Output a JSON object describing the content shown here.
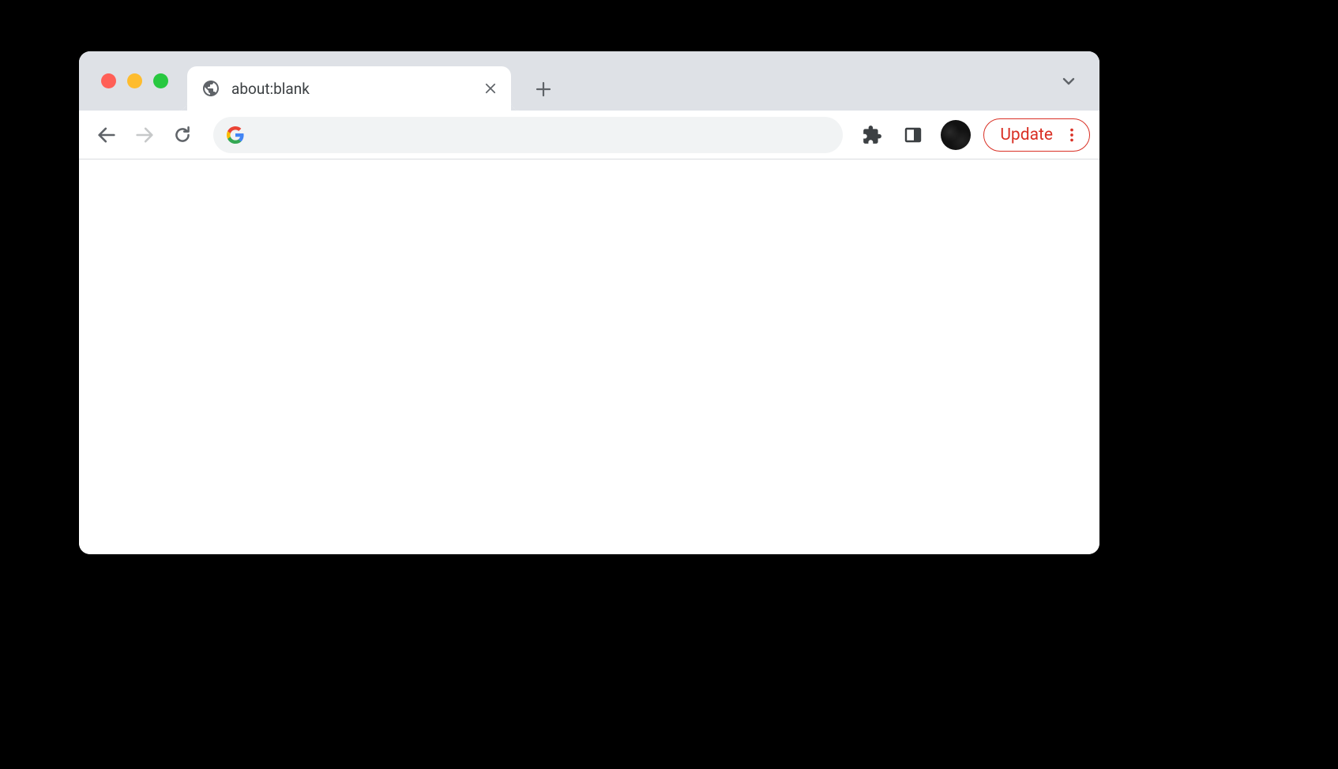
{
  "tab": {
    "title": "about:blank"
  },
  "omnibox": {
    "value": "",
    "placeholder": ""
  },
  "update": {
    "label": "Update"
  },
  "colors": {
    "accent_red": "#d93025",
    "tab_strip_bg": "#dee1e6"
  }
}
